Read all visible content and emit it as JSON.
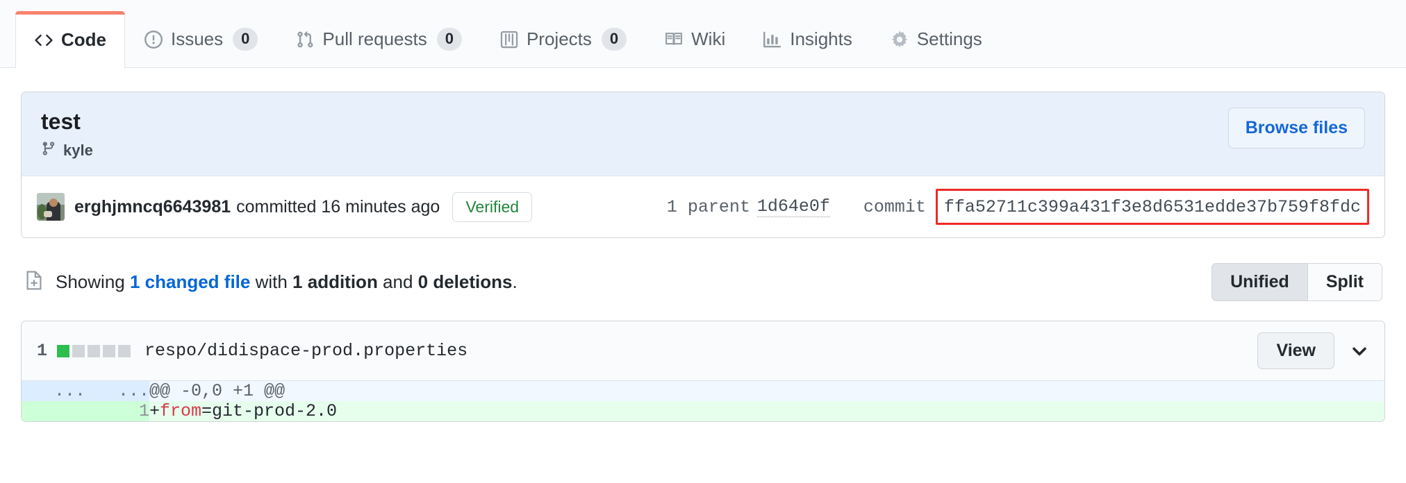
{
  "tabs": [
    {
      "label": "Code",
      "icon": "code-icon",
      "counter": null,
      "selected": true
    },
    {
      "label": "Issues",
      "icon": "issue-opened-icon",
      "counter": "0",
      "selected": false
    },
    {
      "label": "Pull requests",
      "icon": "git-pull-request-icon",
      "counter": "0",
      "selected": false
    },
    {
      "label": "Projects",
      "icon": "project-icon",
      "counter": "0",
      "selected": false
    },
    {
      "label": "Wiki",
      "icon": "book-icon",
      "counter": null,
      "selected": false
    },
    {
      "label": "Insights",
      "icon": "graph-icon",
      "counter": null,
      "selected": false
    },
    {
      "label": "Settings",
      "icon": "gear-icon",
      "counter": null,
      "selected": false
    }
  ],
  "commit": {
    "title": "test",
    "branch_icon": "git-branch-icon",
    "branch": "kyle",
    "browse_files_label": "Browse files",
    "avatar_name": "author-avatar",
    "author": "erghjmncq6643981",
    "committed_text": "committed 16 minutes ago",
    "verified_label": "Verified",
    "parent_label": "1 parent",
    "parent_sha": "1d64e0f",
    "commit_label": "commit",
    "commit_sha": "ffa52711c399a431f3e8d6531edde37b759f8fdc",
    "highlight_color": "#ee2b27"
  },
  "summary": {
    "icon": "diff-file-icon",
    "prefix": "Showing ",
    "changed_files_link": "1 changed file",
    "middle": " with ",
    "additions": "1 addition",
    "conjunction": " and ",
    "deletions": "0 deletions",
    "suffix": "."
  },
  "diff_view": {
    "unified_label": "Unified",
    "split_label": "Split",
    "selected": "Unified"
  },
  "file": {
    "count": "1",
    "stat_squares": [
      "add",
      "neutral",
      "neutral",
      "neutral",
      "neutral"
    ],
    "path": "respo/didispace-prod.properties",
    "view_label": "View",
    "chevron_icon": "chevron-down-icon",
    "rows": [
      {
        "type": "hunk",
        "old_line": "...",
        "new_line": "...",
        "content": "@@ -0,0 +1 @@"
      },
      {
        "type": "add",
        "old_line": "",
        "new_line": "1",
        "marker": "+",
        "token_key": "from",
        "token_rest": "=git-prod-2.0"
      }
    ]
  }
}
